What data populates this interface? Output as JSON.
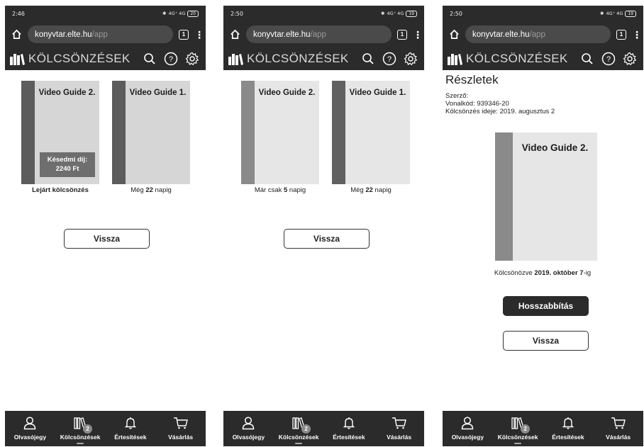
{
  "screens": [
    {
      "status": {
        "time": "2:46",
        "network": "4G⁺ 4G",
        "battery": "20"
      },
      "browser": {
        "url_host": "konyvtar.elte.hu",
        "url_path": "/app",
        "tab_count": "1"
      },
      "app": {
        "title": "KÖLCSÖNZÉSEK"
      },
      "books": [
        {
          "title": "Video Guide 2.",
          "fee_label": "Késedmi díj:",
          "fee_amount": "2240 Ft",
          "caption": "Lejárt kölcsönzés"
        },
        {
          "title": "Video Guide 1.",
          "caption_pre": "Még ",
          "caption_num": "22",
          "caption_post": " napig"
        }
      ],
      "back_label": "Vissza"
    },
    {
      "status": {
        "time": "2:50",
        "network": "4G⁺ 4G",
        "battery": "19"
      },
      "browser": {
        "url_host": "konyvtar.elte.hu",
        "url_path": "/app",
        "tab_count": "1"
      },
      "app": {
        "title": "KÖLCSÖNZÉSEK"
      },
      "books": [
        {
          "title": "Video Guide 2.",
          "caption_pre": "Már csak ",
          "caption_num": "5",
          "caption_post": " napig"
        },
        {
          "title": "Video Guide 1.",
          "caption_pre": "Még ",
          "caption_num": "22",
          "caption_post": " napig"
        }
      ],
      "back_label": "Vissza"
    },
    {
      "status": {
        "time": "2:50",
        "network": "4G⁺ 4G",
        "battery": "19"
      },
      "browser": {
        "url_host": "konyvtar.elte.hu",
        "url_path": "/app",
        "tab_count": "1"
      },
      "app": {
        "title": "KÖLCSÖNZÉSEK"
      },
      "details": {
        "heading": "Részletek",
        "author": "Szerző:",
        "barcode": "Vonalkód: 939346-20",
        "loan_date": "Kölcsönzés ideje: 2019. augusztus 2",
        "book_title": "Video Guide 2.",
        "due_pre": "Kölcsönözve ",
        "due_bold": "2019. október 7",
        "due_post": "-ig",
        "extend_label": "Hosszabbítás",
        "back_label": "Vissza"
      }
    }
  ],
  "nav": {
    "items": [
      {
        "label": "Olvasójegy",
        "icon": "user-icon"
      },
      {
        "label": "Kölcsönzések",
        "icon": "books-icon",
        "badge": "2"
      },
      {
        "label": "Értesítések",
        "icon": "bell-icon"
      },
      {
        "label": "Vásárlás",
        "icon": "cart-icon"
      }
    ]
  },
  "colors": {
    "bar": "#2b2b2b",
    "spine_dark": "#5c5c5c",
    "spine_light": "#8a8a8a",
    "fee_box": "#6e6e6e"
  }
}
